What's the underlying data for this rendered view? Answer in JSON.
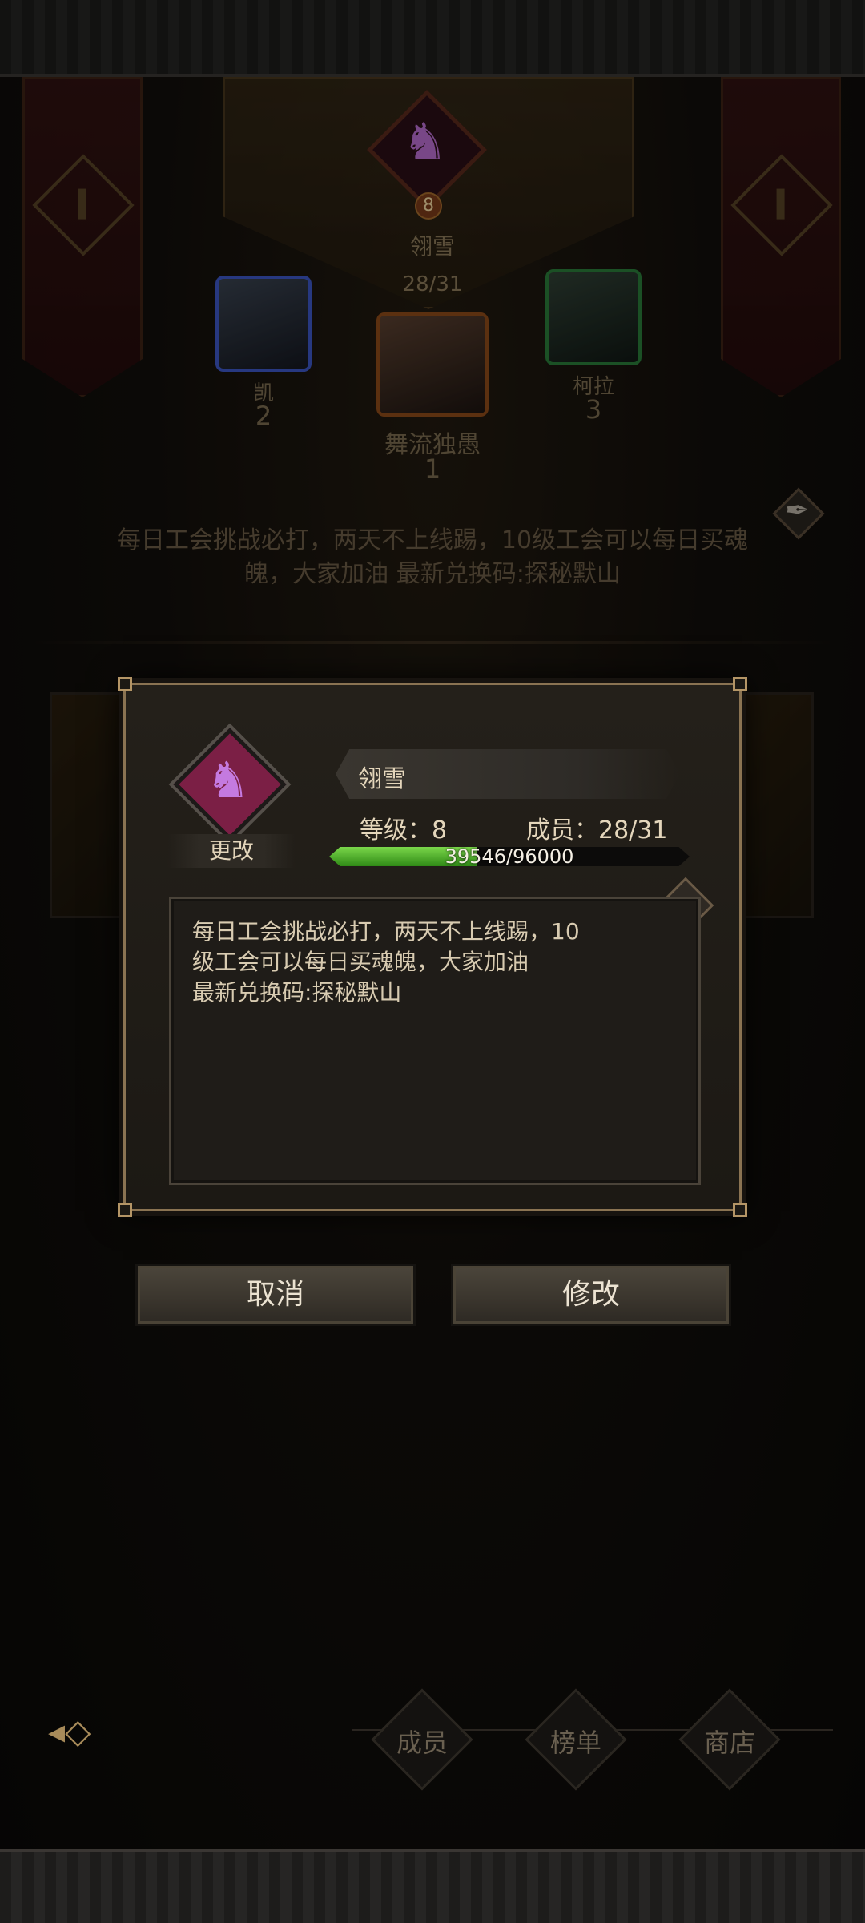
{
  "guild": {
    "name": "翎雪",
    "level_badge": "8",
    "member_count": "28/31",
    "notice_short": "每日工会挑战必打，两天不上线踢，10级工会可以每日买魂魄，大家加油 最新兑换码:探秘默山"
  },
  "top_members": [
    {
      "name": "凯",
      "rank": "2"
    },
    {
      "name": "舞流独愚",
      "rank": "1"
    },
    {
      "name": "柯拉",
      "rank": "3"
    }
  ],
  "dialog": {
    "change_label": "更改",
    "name": "翎雪",
    "level_text": "等级：8",
    "members_text": "成员：28/31",
    "xp_text": "39546/96000",
    "xp_fraction": 0.412,
    "notice_text": "每日工会挑战必打，两天不上线踢，10\n级工会可以每日买魂魄，大家加油\n最新兑换码:探秘默山"
  },
  "buttons": {
    "cancel": "取消",
    "modify": "修改"
  },
  "nav": {
    "members": "成员",
    "rank": "榜单",
    "shop": "商店"
  },
  "icons": {
    "guild_emblem": "knight-icon",
    "edit": "quill-icon",
    "back": "back-arrow-icon"
  },
  "colors": {
    "xp_fill": "#4fb52a",
    "emblem": "#b86ed0",
    "accent_gold": "#8a7352"
  }
}
